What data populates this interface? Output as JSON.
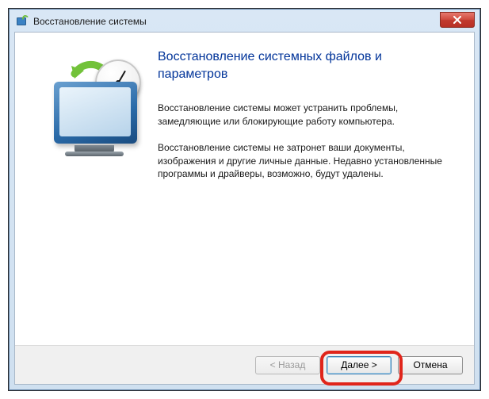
{
  "window": {
    "title": "Восстановление системы"
  },
  "heading": "Восстановление системных файлов и параметров",
  "paragraph1": "Восстановление системы может устранить проблемы, замедляющие или блокирующие работу компьютера.",
  "paragraph2": "Восстановление системы не затронет ваши документы, изображения и другие личные данные. Недавно установленные программы и драйверы, возможно, будут удалены.",
  "buttons": {
    "back": "< Назад",
    "next": "Далее >",
    "cancel": "Отмена"
  }
}
